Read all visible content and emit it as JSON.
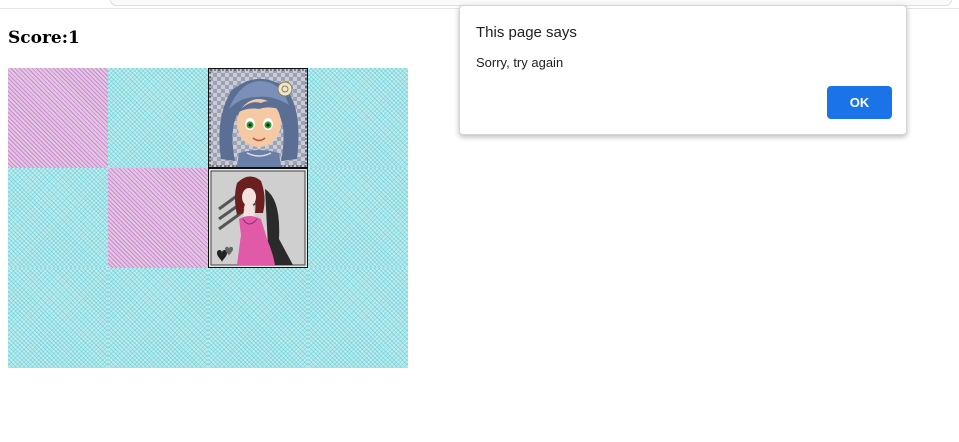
{
  "game": {
    "score_label": "Score:1",
    "board": {
      "columns": 4,
      "rows": 3,
      "cells": [
        [
          "pink",
          "cyan",
          "card-blue-haired-girl",
          "cyan"
        ],
        [
          "cyan",
          "pink",
          "card-girl-pink-dress",
          "cyan"
        ],
        [
          "cyan",
          "cyan",
          "cyan",
          "cyan"
        ]
      ]
    }
  },
  "dialog": {
    "title": "This page says",
    "message": "Sorry, try again",
    "ok_label": "OK"
  },
  "colors": {
    "cyan_tile": "#bfeef0",
    "pink_tile": "#e6c4e6",
    "ok_button": "#1a73e8"
  }
}
